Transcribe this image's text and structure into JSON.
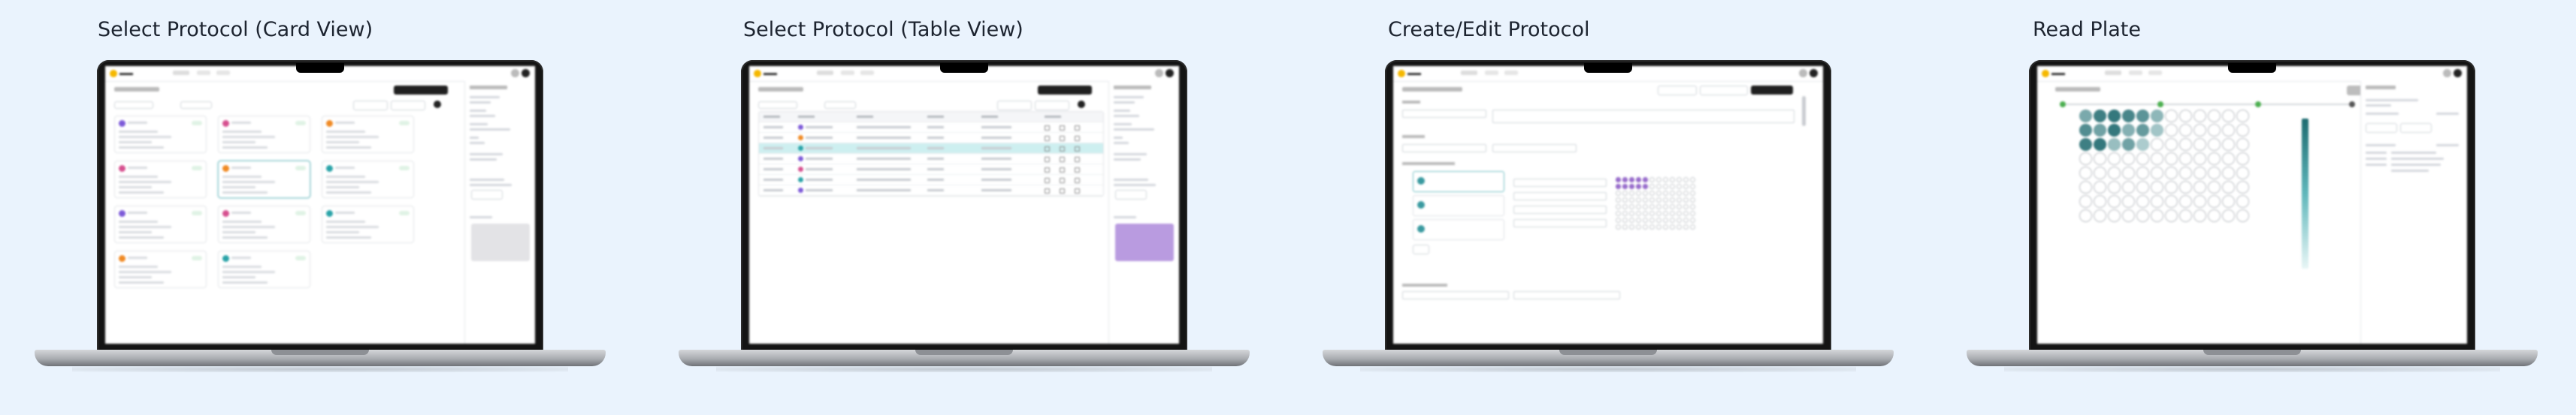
{
  "panels": [
    {
      "title": "Select Protocol (Card View)"
    },
    {
      "title": "Select Protocol (Table View)"
    },
    {
      "title": "Create/Edit Protocol"
    },
    {
      "title": "Read Plate"
    }
  ],
  "colors": {
    "background": "#eaf3fd",
    "teal_accent": "#3a9aa0",
    "purple_wells": "#9b6fcf",
    "logo_yellow": "#f5b800",
    "selected_row": "#cdeff0"
  },
  "icons": [
    "laptop-icon",
    "logo-icon",
    "avatar-icon"
  ],
  "card_view": {
    "avatars": [
      "#7c5ad8",
      "#d6508f",
      "#f08a24",
      "#d6508f",
      "#f08a24",
      "#2aa3a8",
      "#7c5ad8",
      "#d6508f",
      "#2aa3a8",
      "#f08a24",
      "#2aa3a8"
    ]
  },
  "table_view": {
    "row_dots": [
      "#7c5ad8",
      "#f08a24",
      "#2aa3a8",
      "#7c5ad8",
      "#d6508f",
      "#2aa3a8",
      "#7c5ad8"
    ],
    "selected_row_index": 2
  },
  "read_plate": {
    "filled_wells": [
      [
        0,
        0.55
      ],
      [
        1,
        0.85
      ],
      [
        2,
        0.9
      ],
      [
        3,
        0.8
      ],
      [
        4,
        0.7
      ],
      [
        5,
        0.45
      ],
      [
        12,
        0.75
      ],
      [
        13,
        0.6
      ],
      [
        14,
        0.9
      ],
      [
        15,
        0.5
      ],
      [
        16,
        0.65
      ],
      [
        17,
        0.35
      ],
      [
        24,
        0.85
      ],
      [
        25,
        0.9
      ],
      [
        26,
        0.4
      ],
      [
        27,
        0.6
      ],
      [
        28,
        0.3
      ]
    ]
  }
}
